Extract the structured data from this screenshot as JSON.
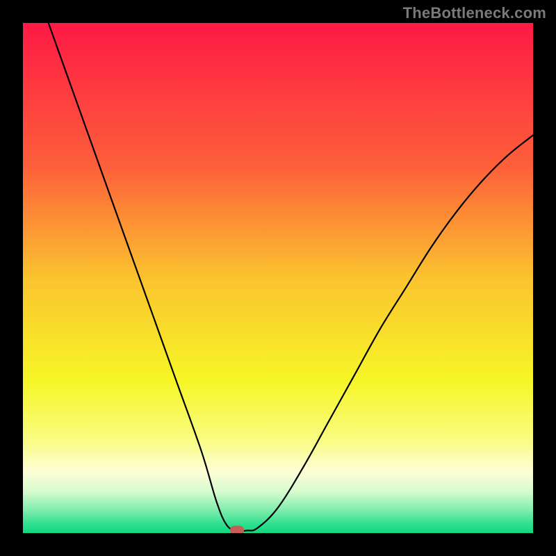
{
  "watermark": "TheBottleneck.com",
  "chart_data": {
    "type": "line",
    "title": "",
    "xlabel": "",
    "ylabel": "",
    "xlim": [
      0,
      100
    ],
    "ylim": [
      0,
      100
    ],
    "grid": false,
    "legend": false,
    "series": [
      {
        "name": "bottleneck-curve",
        "x": [
          5,
          10,
          15,
          20,
          25,
          30,
          35,
          38,
          40,
          42,
          44,
          46,
          50,
          55,
          60,
          65,
          70,
          75,
          80,
          85,
          90,
          95,
          100
        ],
        "y": [
          100,
          86,
          72,
          58,
          44,
          30,
          16,
          6,
          1.5,
          0.5,
          0.5,
          1,
          5,
          13,
          22,
          31,
          40,
          48,
          56,
          63,
          69,
          74,
          78
        ]
      }
    ],
    "marker": {
      "x": 42,
      "y": 0.5,
      "color": "#c65d56"
    },
    "background_gradient": {
      "stops": [
        {
          "pos": 0.0,
          "color": "#fe1a45"
        },
        {
          "pos": 0.28,
          "color": "#fd5f3a"
        },
        {
          "pos": 0.5,
          "color": "#fbc32f"
        },
        {
          "pos": 0.7,
          "color": "#f6f626"
        },
        {
          "pos": 0.82,
          "color": "#f9fc84"
        },
        {
          "pos": 0.88,
          "color": "#fdfed8"
        },
        {
          "pos": 0.92,
          "color": "#d4fbcd"
        },
        {
          "pos": 0.955,
          "color": "#7eedac"
        },
        {
          "pos": 0.985,
          "color": "#29de8d"
        },
        {
          "pos": 1.0,
          "color": "#11d87f"
        }
      ]
    }
  }
}
